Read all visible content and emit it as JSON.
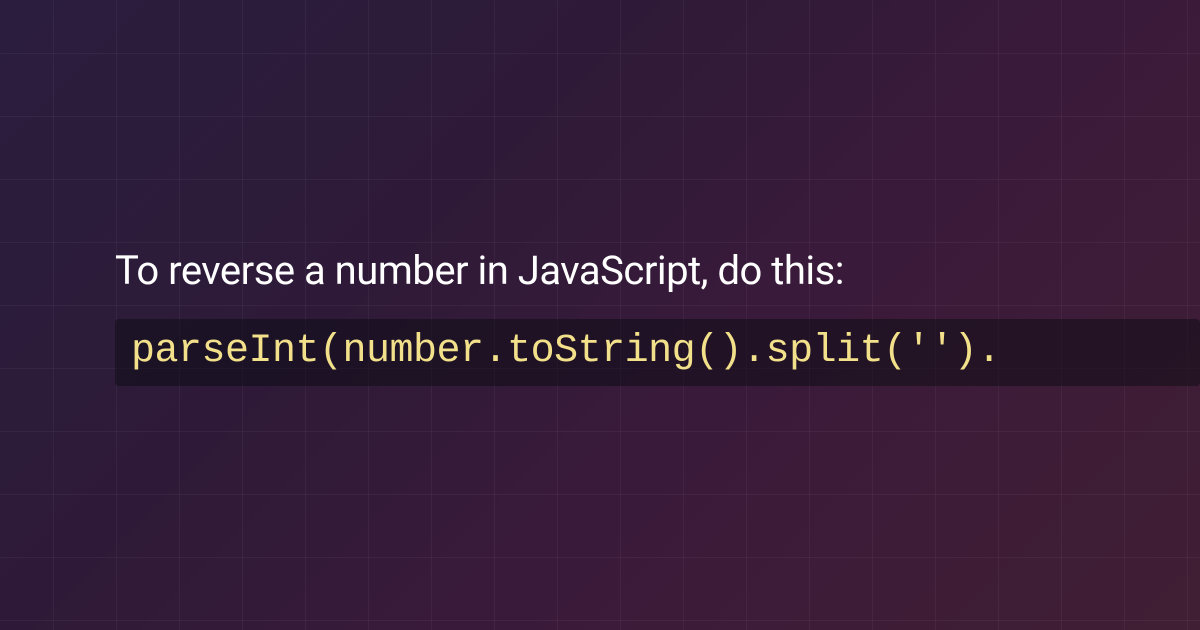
{
  "content": {
    "description": "To reverse a number in JavaScript, do this:",
    "code": "parseInt(number.toString().split('')."
  },
  "colors": {
    "background_start": "#2b1d3e",
    "background_end": "#401e34",
    "text": "#ffffff",
    "code_text": "#f2e08a",
    "code_background": "rgba(15, 12, 22, 0.55)",
    "grid_line": "rgba(255, 255, 255, 0.045)"
  }
}
